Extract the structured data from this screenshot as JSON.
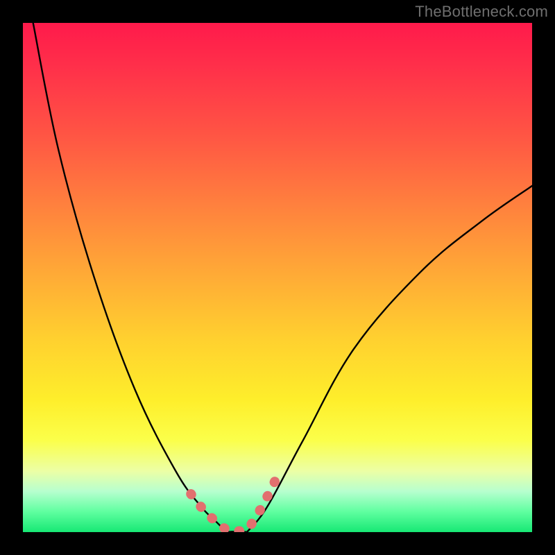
{
  "watermark": "TheBottleneck.com",
  "chart_data": {
    "type": "line",
    "title": "",
    "xlabel": "",
    "ylabel": "",
    "xlim": [
      0,
      1
    ],
    "ylim": [
      0,
      1
    ],
    "series": [
      {
        "name": "curve-left",
        "x": [
          0.02,
          0.07,
          0.14,
          0.22,
          0.3,
          0.35,
          0.38,
          0.4
        ],
        "y": [
          1.0,
          0.75,
          0.5,
          0.28,
          0.12,
          0.05,
          0.02,
          0.0
        ]
      },
      {
        "name": "curve-right",
        "x": [
          0.44,
          0.48,
          0.55,
          0.65,
          0.78,
          0.9,
          1.0
        ],
        "y": [
          0.0,
          0.05,
          0.18,
          0.36,
          0.51,
          0.61,
          0.68
        ]
      },
      {
        "name": "highlight-left",
        "x": [
          0.33,
          0.345,
          0.36,
          0.375,
          0.39,
          0.4
        ],
        "y": [
          0.075,
          0.055,
          0.038,
          0.024,
          0.012,
          0.004
        ]
      },
      {
        "name": "highlight-bottom",
        "x": [
          0.4,
          0.41,
          0.42,
          0.43,
          0.44
        ],
        "y": [
          0.003,
          0.002,
          0.002,
          0.002,
          0.003
        ]
      },
      {
        "name": "highlight-right",
        "x": [
          0.445,
          0.455,
          0.465,
          0.475,
          0.485,
          0.495
        ],
        "y": [
          0.01,
          0.025,
          0.042,
          0.06,
          0.08,
          0.1
        ]
      }
    ],
    "gradient_stops": [
      {
        "pos": 0.0,
        "color": "#ff1a4b"
      },
      {
        "pos": 0.22,
        "color": "#ff5544"
      },
      {
        "pos": 0.48,
        "color": "#ffa637"
      },
      {
        "pos": 0.74,
        "color": "#feee2b"
      },
      {
        "pos": 0.92,
        "color": "#b7ffcf"
      },
      {
        "pos": 1.0,
        "color": "#17e874"
      }
    ],
    "highlight_color": "#e26f6f",
    "curve_color": "#000000"
  }
}
